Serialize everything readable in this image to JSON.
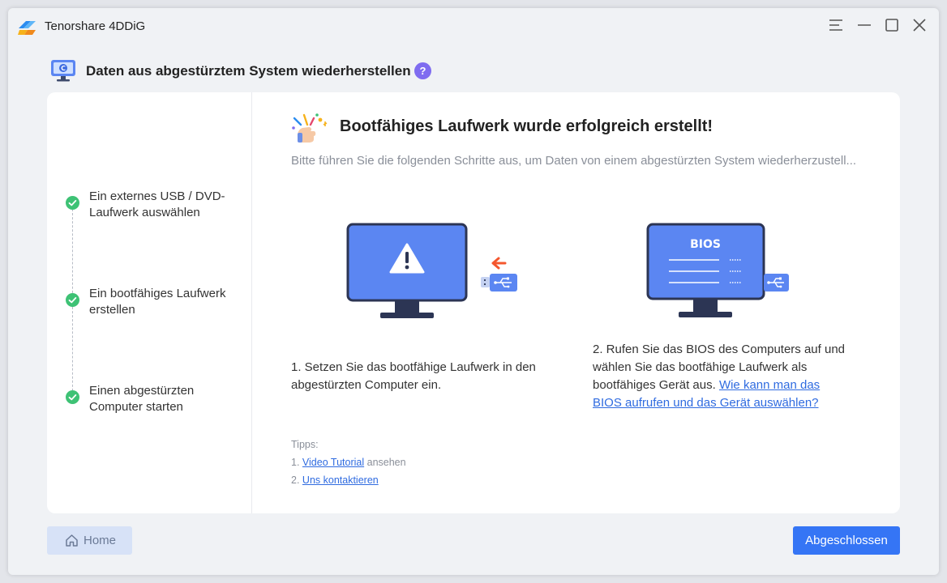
{
  "window": {
    "title": "Tenorshare 4DDiG",
    "logo_icon": "4ddig-logo-icon"
  },
  "controls": {
    "menu_icon": "menu-icon",
    "minimize_icon": "minimize-icon",
    "maximize_icon": "maximize-icon",
    "close_icon": "close-icon"
  },
  "header": {
    "title": "Daten aus abgestürztem System wiederherstellen",
    "help_label": "?"
  },
  "steps": [
    {
      "label": "Ein externes USB / DVD-Laufwerk auswählen",
      "status": "done"
    },
    {
      "label": "Ein bootfähiges Laufwerk erstellen",
      "status": "done"
    },
    {
      "label": "Einen abgestürzten Computer starten",
      "status": "done"
    }
  ],
  "main": {
    "title": "Bootfähiges Laufwerk wurde erfolgreich erstellt!",
    "subtitle": "Bitte führen Sie die folgenden Schritte aus, um Daten von einem abgestürzten System wiederherzustell...",
    "instruction1": "1. Setzen Sie das bootfähige Laufwerk in den abgestürzten Computer ein.",
    "instruction2_text": "2. Rufen Sie das BIOS des Computers auf und wählen Sie das bootfähige Laufwerk als bootfähiges Gerät aus.",
    "instruction2_link": "Wie kann man das BIOS aufrufen und das Gerät auswählen?",
    "bios_label": "BIOS"
  },
  "tips": {
    "heading": "Tipps:",
    "item1_prefix": "1.",
    "item1_link": "Video Tutorial",
    "item1_suffix": "ansehen",
    "item2_prefix": "2.",
    "item2_link": "Uns kontaktieren"
  },
  "footer": {
    "home_label": "Home",
    "done_label": "Abgeschlossen"
  },
  "colors": {
    "accent": "#3575f5",
    "success": "#3ec275",
    "help": "#7f6cf0",
    "monitor": "#5b86f2",
    "arrow": "#f4572e"
  }
}
